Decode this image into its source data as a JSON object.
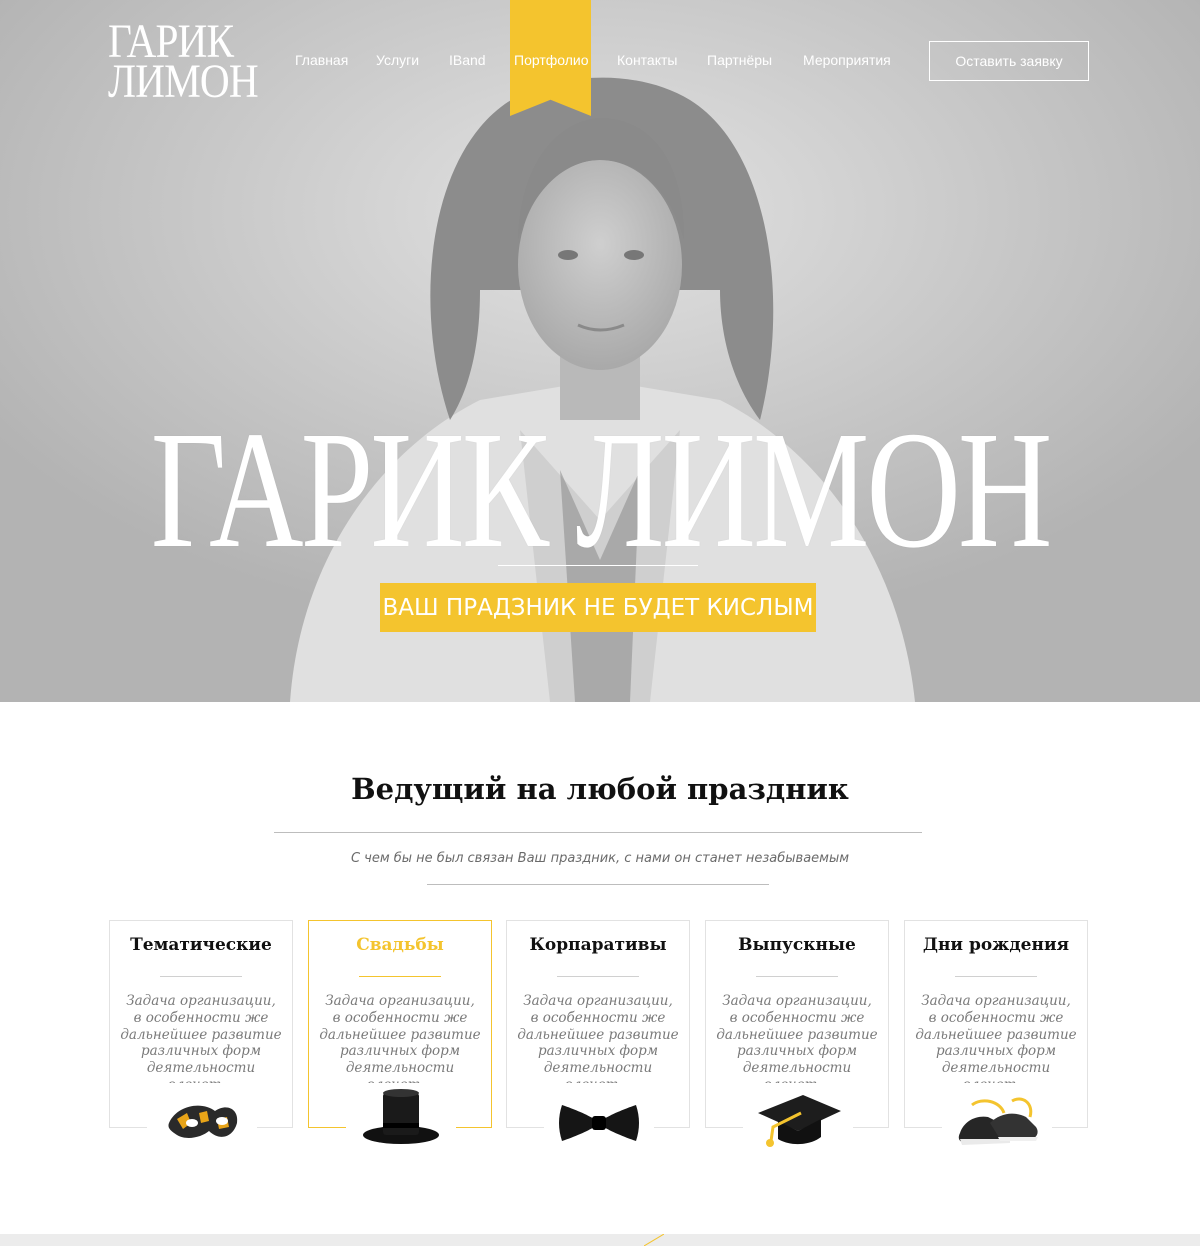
{
  "colors": {
    "accent": "#f4c42e",
    "hero_bg": "#c9c9c9",
    "text_dark": "#111111",
    "text_muted": "#7a7a7a"
  },
  "header": {
    "logo_line1": "ГАРИК",
    "logo_line2": "ЛИМОН",
    "nav": [
      {
        "label": "Главная",
        "active": false
      },
      {
        "label": "Услуги",
        "active": false
      },
      {
        "label": "IBand",
        "active": false
      },
      {
        "label": "Портфолио",
        "active": true
      },
      {
        "label": "Контакты",
        "active": false
      },
      {
        "label": "Партнёры",
        "active": false
      },
      {
        "label": "Мероприятия",
        "active": false
      }
    ],
    "cta_label": "Оставить заявку"
  },
  "hero": {
    "title": "ГАРИК ЛИМОН",
    "tagline": "ВАШ ПРАДЗНИК НЕ БУДЕТ КИСЛЫМ"
  },
  "services": {
    "title": "Ведущий на любой праздник",
    "subtitle": "С чем бы не был связан Ваш праздник, с нами он станет незабываемым",
    "cards": [
      {
        "title": "Тематические",
        "text_lines": [
          "Задача организации,",
          "в особенности же",
          "дальнейшее развитие",
          "различных форм",
          "деятельности влечет..."
        ],
        "icon": "mask-icon",
        "active": false
      },
      {
        "title": "Свадьбы",
        "text_lines": [
          "Задача организации,",
          "в особенности же",
          "дальнейшее развитие",
          "различных форм",
          "деятельности влечет..."
        ],
        "icon": "top-hat-icon",
        "active": true
      },
      {
        "title": "Корпаративы",
        "text_lines": [
          "Задача организации,",
          "в особенности же",
          "дальнейшее развитие",
          "различных форм",
          "деятельности влечет..."
        ],
        "icon": "bow-tie-icon",
        "active": false
      },
      {
        "title": "Выпускные",
        "text_lines": [
          "Задача организации,",
          "в особенности же",
          "дальнейшее развитие",
          "различных форм",
          "деятельности влечет..."
        ],
        "icon": "graduation-cap-icon",
        "active": false
      },
      {
        "title": "Дни рождения",
        "text_lines": [
          "Задача организации,",
          "в особенности же",
          "дальнейшее развитие",
          "различных форм",
          "деятельности влечет..."
        ],
        "icon": "sneakers-icon",
        "active": false
      }
    ]
  }
}
